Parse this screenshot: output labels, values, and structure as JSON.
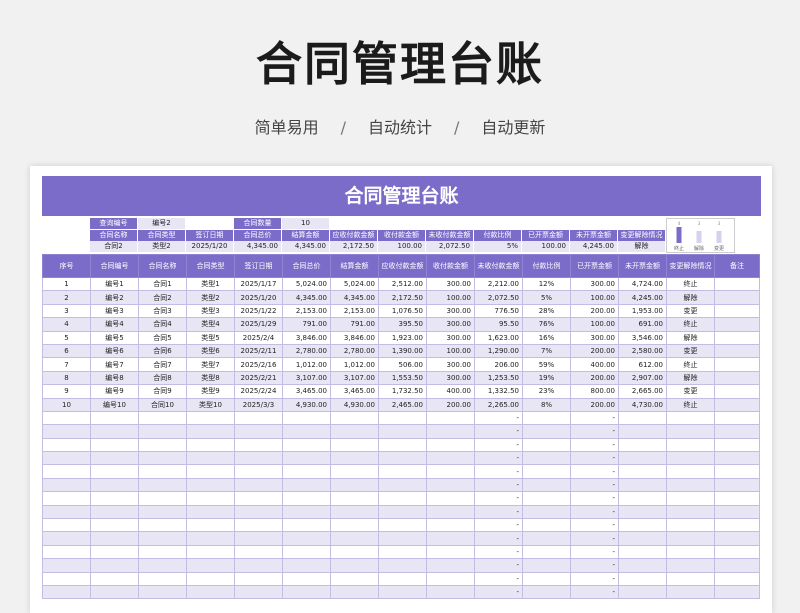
{
  "title": "合同管理台账",
  "subtitle": [
    "简单易用",
    "/",
    "自动统计",
    "/",
    "自动更新"
  ],
  "sheet_title": "合同管理台账",
  "query": {
    "label": "查询编号",
    "value": "编号2",
    "count_label": "合同数量",
    "count_value": "10",
    "headers": [
      "合同名称",
      "合同类型",
      "签订日期",
      "合同总价",
      "结算金额",
      "应收付款金额",
      "收付款金额",
      "未收付款金额",
      "付款比例",
      "已开票金额",
      "未开票金额",
      "变更解除情况"
    ],
    "values": [
      "合同2",
      "类型2",
      "2025/1/20",
      "4,345.00",
      "4,345.00",
      "2,172.50",
      "100.00",
      "2,072.50",
      "5%",
      "100.00",
      "4,245.00",
      "解除"
    ]
  },
  "mini_chart": {
    "labels": [
      "终止",
      "解除",
      "变更"
    ],
    "values": [
      4,
      3,
      3
    ],
    "color": "#7b6cc9"
  },
  "columns": [
    "序号",
    "合同编号",
    "合同名称",
    "合同类型",
    "签订日期",
    "合同总价",
    "结算金额",
    "应收付款金额",
    "收付款金额",
    "未收付款金额",
    "付款比例",
    "已开票金额",
    "未开票金额",
    "变更解除情况",
    "备注"
  ],
  "rows": [
    [
      "1",
      "编号1",
      "合同1",
      "类型1",
      "2025/1/17",
      "5,024.00",
      "5,024.00",
      "2,512.00",
      "300.00",
      "2,212.00",
      "12%",
      "300.00",
      "4,724.00",
      "终止",
      ""
    ],
    [
      "2",
      "编号2",
      "合同2",
      "类型2",
      "2025/1/20",
      "4,345.00",
      "4,345.00",
      "2,172.50",
      "100.00",
      "2,072.50",
      "5%",
      "100.00",
      "4,245.00",
      "解除",
      ""
    ],
    [
      "3",
      "编号3",
      "合同3",
      "类型3",
      "2025/1/22",
      "2,153.00",
      "2,153.00",
      "1,076.50",
      "300.00",
      "776.50",
      "28%",
      "200.00",
      "1,953.00",
      "变更",
      ""
    ],
    [
      "4",
      "编号4",
      "合同4",
      "类型4",
      "2025/1/29",
      "791.00",
      "791.00",
      "395.50",
      "300.00",
      "95.50",
      "76%",
      "100.00",
      "691.00",
      "终止",
      ""
    ],
    [
      "5",
      "编号5",
      "合同5",
      "类型5",
      "2025/2/4",
      "3,846.00",
      "3,846.00",
      "1,923.00",
      "300.00",
      "1,623.00",
      "16%",
      "300.00",
      "3,546.00",
      "解除",
      ""
    ],
    [
      "6",
      "编号6",
      "合同6",
      "类型6",
      "2025/2/11",
      "2,780.00",
      "2,780.00",
      "1,390.00",
      "100.00",
      "1,290.00",
      "7%",
      "200.00",
      "2,580.00",
      "变更",
      ""
    ],
    [
      "7",
      "编号7",
      "合同7",
      "类型7",
      "2025/2/16",
      "1,012.00",
      "1,012.00",
      "506.00",
      "300.00",
      "206.00",
      "59%",
      "400.00",
      "612.00",
      "终止",
      ""
    ],
    [
      "8",
      "编号8",
      "合同8",
      "类型8",
      "2025/2/21",
      "3,107.00",
      "3,107.00",
      "1,553.50",
      "300.00",
      "1,253.50",
      "19%",
      "200.00",
      "2,907.00",
      "解除",
      ""
    ],
    [
      "9",
      "编号9",
      "合同9",
      "类型9",
      "2025/2/24",
      "3,465.00",
      "3,465.00",
      "1,732.50",
      "400.00",
      "1,332.50",
      "23%",
      "800.00",
      "2,665.00",
      "变更",
      ""
    ],
    [
      "10",
      "编号10",
      "合同10",
      "类型10",
      "2025/3/3",
      "4,930.00",
      "4,930.00",
      "2,465.00",
      "200.00",
      "2,265.00",
      "8%",
      "200.00",
      "4,730.00",
      "终止",
      ""
    ],
    [
      "",
      "",
      "",
      "",
      "",
      "",
      "",
      "",
      "",
      "-",
      "",
      "-",
      "",
      "",
      ""
    ],
    [
      "",
      "",
      "",
      "",
      "",
      "",
      "",
      "",
      "",
      "-",
      "",
      "-",
      "",
      "",
      ""
    ],
    [
      "",
      "",
      "",
      "",
      "",
      "",
      "",
      "",
      "",
      "-",
      "",
      "-",
      "",
      "",
      ""
    ],
    [
      "",
      "",
      "",
      "",
      "",
      "",
      "",
      "",
      "",
      "-",
      "",
      "-",
      "",
      "",
      ""
    ],
    [
      "",
      "",
      "",
      "",
      "",
      "",
      "",
      "",
      "",
      "-",
      "",
      "-",
      "",
      "",
      ""
    ],
    [
      "",
      "",
      "",
      "",
      "",
      "",
      "",
      "",
      "",
      "-",
      "",
      "-",
      "",
      "",
      ""
    ],
    [
      "",
      "",
      "",
      "",
      "",
      "",
      "",
      "",
      "",
      "-",
      "",
      "-",
      "",
      "",
      ""
    ],
    [
      "",
      "",
      "",
      "",
      "",
      "",
      "",
      "",
      "",
      "-",
      "",
      "-",
      "",
      "",
      ""
    ],
    [
      "",
      "",
      "",
      "",
      "",
      "",
      "",
      "",
      "",
      "-",
      "",
      "-",
      "",
      "",
      ""
    ],
    [
      "",
      "",
      "",
      "",
      "",
      "",
      "",
      "",
      "",
      "-",
      "",
      "-",
      "",
      "",
      ""
    ],
    [
      "",
      "",
      "",
      "",
      "",
      "",
      "",
      "",
      "",
      "-",
      "",
      "-",
      "",
      "",
      ""
    ],
    [
      "",
      "",
      "",
      "",
      "",
      "",
      "",
      "",
      "",
      "-",
      "",
      "-",
      "",
      "",
      ""
    ],
    [
      "",
      "",
      "",
      "",
      "",
      "",
      "",
      "",
      "",
      "-",
      "",
      "-",
      "",
      "",
      ""
    ],
    [
      "",
      "",
      "",
      "",
      "",
      "",
      "",
      "",
      "",
      "-",
      "",
      "-",
      "",
      "",
      ""
    ]
  ]
}
